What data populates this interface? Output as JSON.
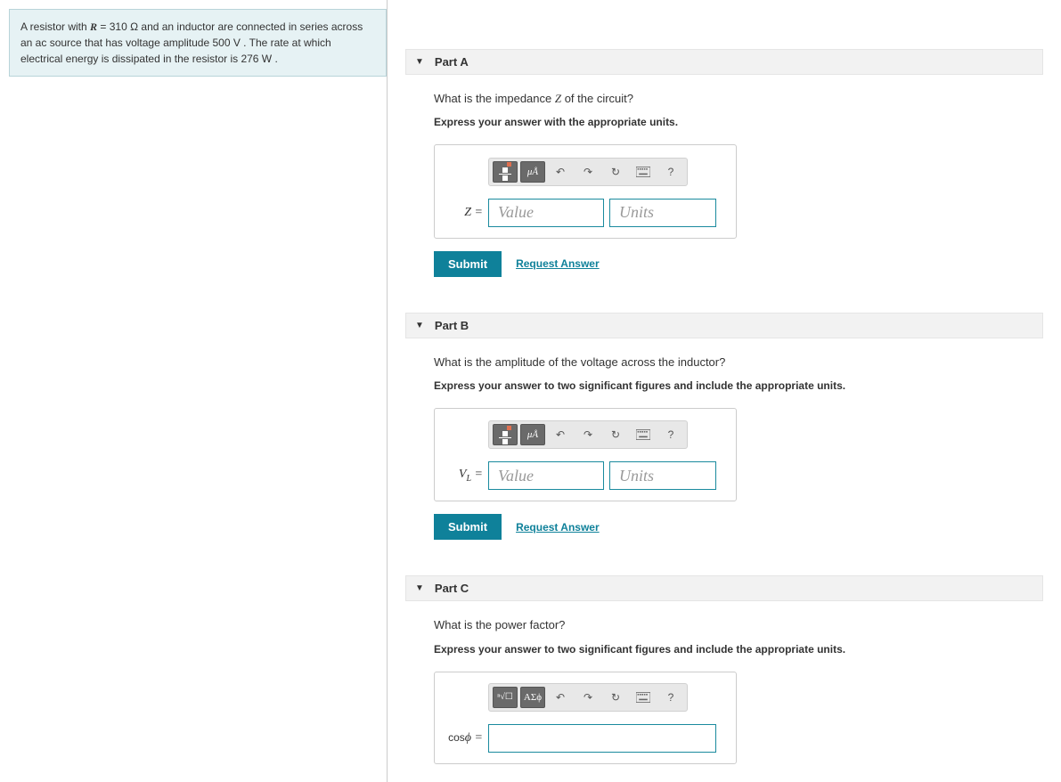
{
  "problem": {
    "text_prefix": "A resistor with ",
    "R_var": "R",
    "R_val": " = 310 ",
    "R_unit": "Ω",
    "text_mid1": " and an inductor are connected in series across an ac source that has voltage amplitude 500 ",
    "V_unit": "V",
    "text_mid2": " . The rate at which electrical energy is dissipated in the resistor is 276 ",
    "W_unit": "W",
    "text_end": " ."
  },
  "parts": {
    "a": {
      "title": "Part A",
      "question_pre": "What is the impedance ",
      "question_var": "Z",
      "question_post": " of the circuit?",
      "instruct": "Express your answer with the appropriate units.",
      "label": "Z =",
      "mu_btn": "μÅ",
      "value_ph": "Value",
      "units_ph": "Units",
      "submit": "Submit",
      "request": "Request Answer",
      "help": "?"
    },
    "b": {
      "title": "Part B",
      "question": "What is the amplitude of the voltage across the inductor?",
      "instruct": "Express your answer to two significant figures and include the appropriate units.",
      "label_base": "V",
      "label_sub": "L",
      "label_eq": " =",
      "mu_btn": "μÅ",
      "value_ph": "Value",
      "units_ph": "Units",
      "submit": "Submit",
      "request": "Request Answer",
      "help": "?"
    },
    "c": {
      "title": "Part C",
      "question": "What is the power factor?",
      "instruct": "Express your answer to two significant figures and include the appropriate units.",
      "label_pre": "cos",
      "label_phi": "ϕ",
      "label_eq": " =",
      "sym_btn": "ΑΣϕ",
      "help": "?"
    }
  }
}
